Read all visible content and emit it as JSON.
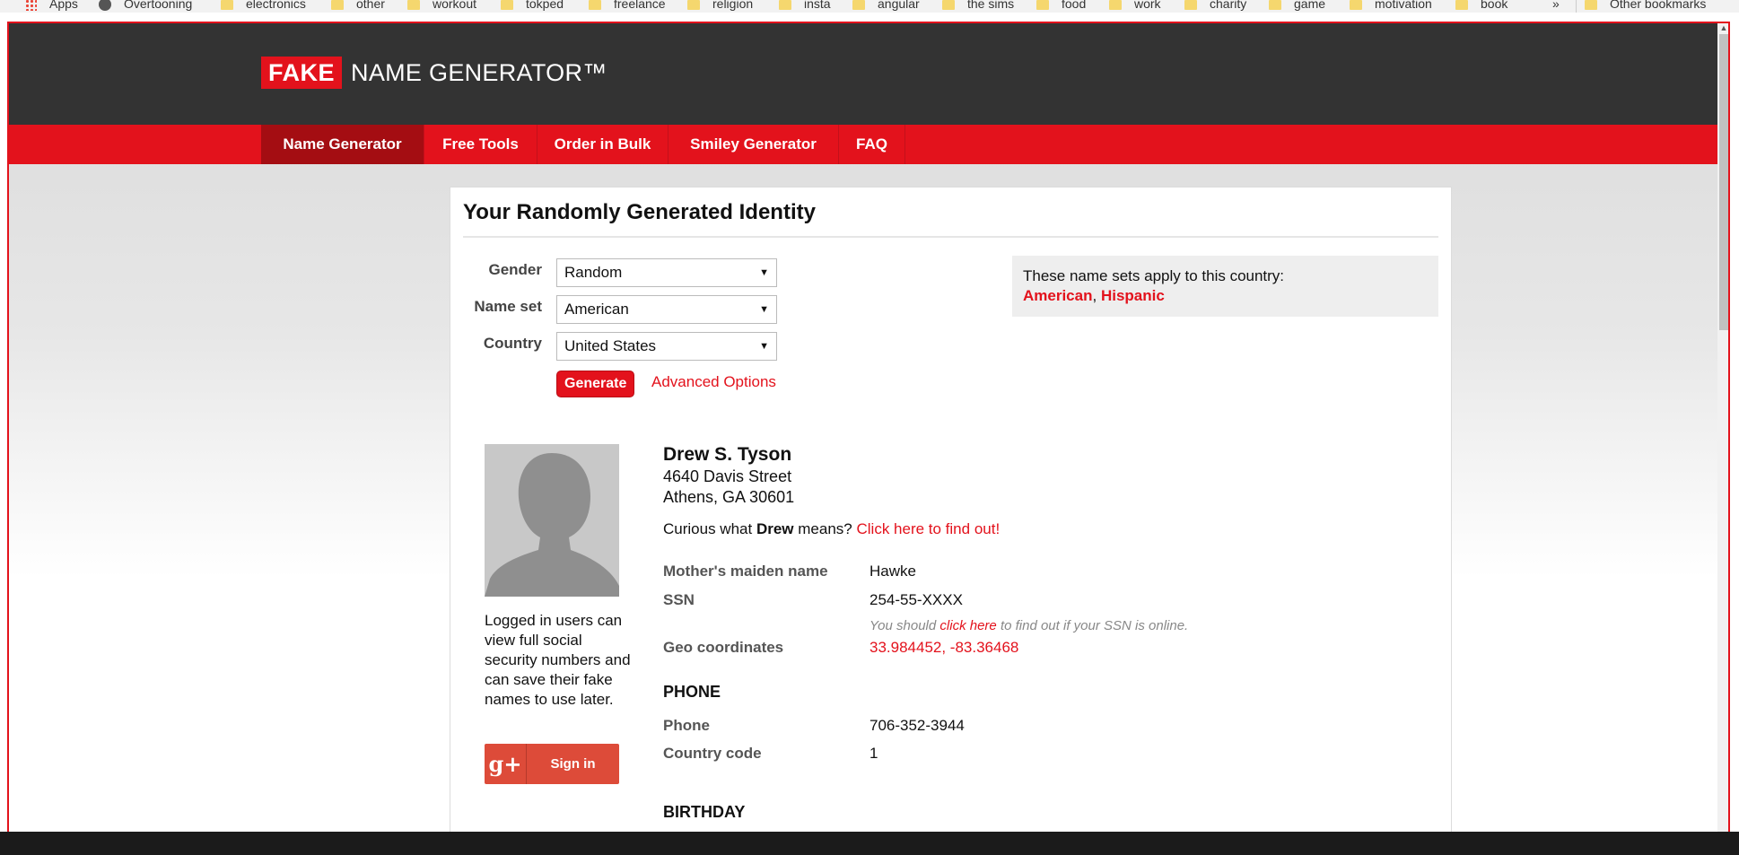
{
  "bookmarks": [
    {
      "label": "Apps",
      "icon": "apps-icon"
    },
    {
      "label": "Overtooning",
      "icon": "globe-icon"
    },
    {
      "label": "electronics",
      "icon": "folder-icon"
    },
    {
      "label": "other",
      "icon": "folder-icon"
    },
    {
      "label": "workout",
      "icon": "folder-icon"
    },
    {
      "label": "tokped",
      "icon": "folder-icon"
    },
    {
      "label": "freelance",
      "icon": "folder-icon"
    },
    {
      "label": "religion",
      "icon": "folder-icon"
    },
    {
      "label": "insta",
      "icon": "folder-icon"
    },
    {
      "label": "angular",
      "icon": "folder-icon"
    },
    {
      "label": "the sims",
      "icon": "folder-icon"
    },
    {
      "label": "food",
      "icon": "folder-icon"
    },
    {
      "label": "work",
      "icon": "folder-icon"
    },
    {
      "label": "charity",
      "icon": "folder-icon"
    },
    {
      "label": "game",
      "icon": "folder-icon"
    },
    {
      "label": "motivation",
      "icon": "folder-icon"
    },
    {
      "label": "book",
      "icon": "folder-icon"
    }
  ],
  "bookmarks_overflow": "»",
  "other_bookmarks": "Other bookmarks",
  "logo": {
    "fake": "FAKE",
    "rest": "NAME GENERATOR™"
  },
  "nav": [
    {
      "label": "Name Generator",
      "active": true
    },
    {
      "label": "Free Tools",
      "active": false
    },
    {
      "label": "Order in Bulk",
      "active": false
    },
    {
      "label": "Smiley Generator",
      "active": false
    },
    {
      "label": "FAQ",
      "active": false
    }
  ],
  "page_title": "Your Randomly Generated Identity",
  "form": {
    "gender_label": "Gender",
    "gender_value": "Random",
    "nameset_label": "Name set",
    "nameset_value": "American",
    "country_label": "Country",
    "country_value": "United States",
    "generate_label": "Generate",
    "advanced_label": "Advanced Options"
  },
  "nameset_info": {
    "text": "These name sets apply to this country:",
    "links": [
      "American",
      "Hispanic"
    ],
    "separator": ","
  },
  "login": {
    "text": "Logged in users can view full social security numbers and can save their fake names to use later.",
    "gplus_icon": "g+",
    "sign_in": "Sign in"
  },
  "identity": {
    "name": "Drew S. Tyson",
    "address_line1": "4640 Davis Street",
    "address_line2": "Athens, GA 30601",
    "curious_prefix": "Curious what",
    "curious_name": "Drew",
    "curious_mid": "means?",
    "curious_link": "Click here to find out!",
    "mothers_maiden_label": "Mother's maiden name",
    "mothers_maiden_value": "Hawke",
    "ssn_label": "SSN",
    "ssn_value": "254-55-XXXX",
    "ssn_note_prefix": "You should",
    "ssn_note_link": "click here",
    "ssn_note_suffix": "to find out if your SSN is online.",
    "geo_label": "Geo coordinates",
    "geo_value": "33.984452, -83.36468",
    "phone_section": "PHONE",
    "phone_label": "Phone",
    "phone_value": "706-352-3944",
    "country_code_label": "Country code",
    "country_code_value": "1",
    "birthday_section": "BIRTHDAY"
  },
  "colors": {
    "brand_red": "#e3121c",
    "header_dark": "#333333",
    "nav_active": "#a40d12"
  }
}
